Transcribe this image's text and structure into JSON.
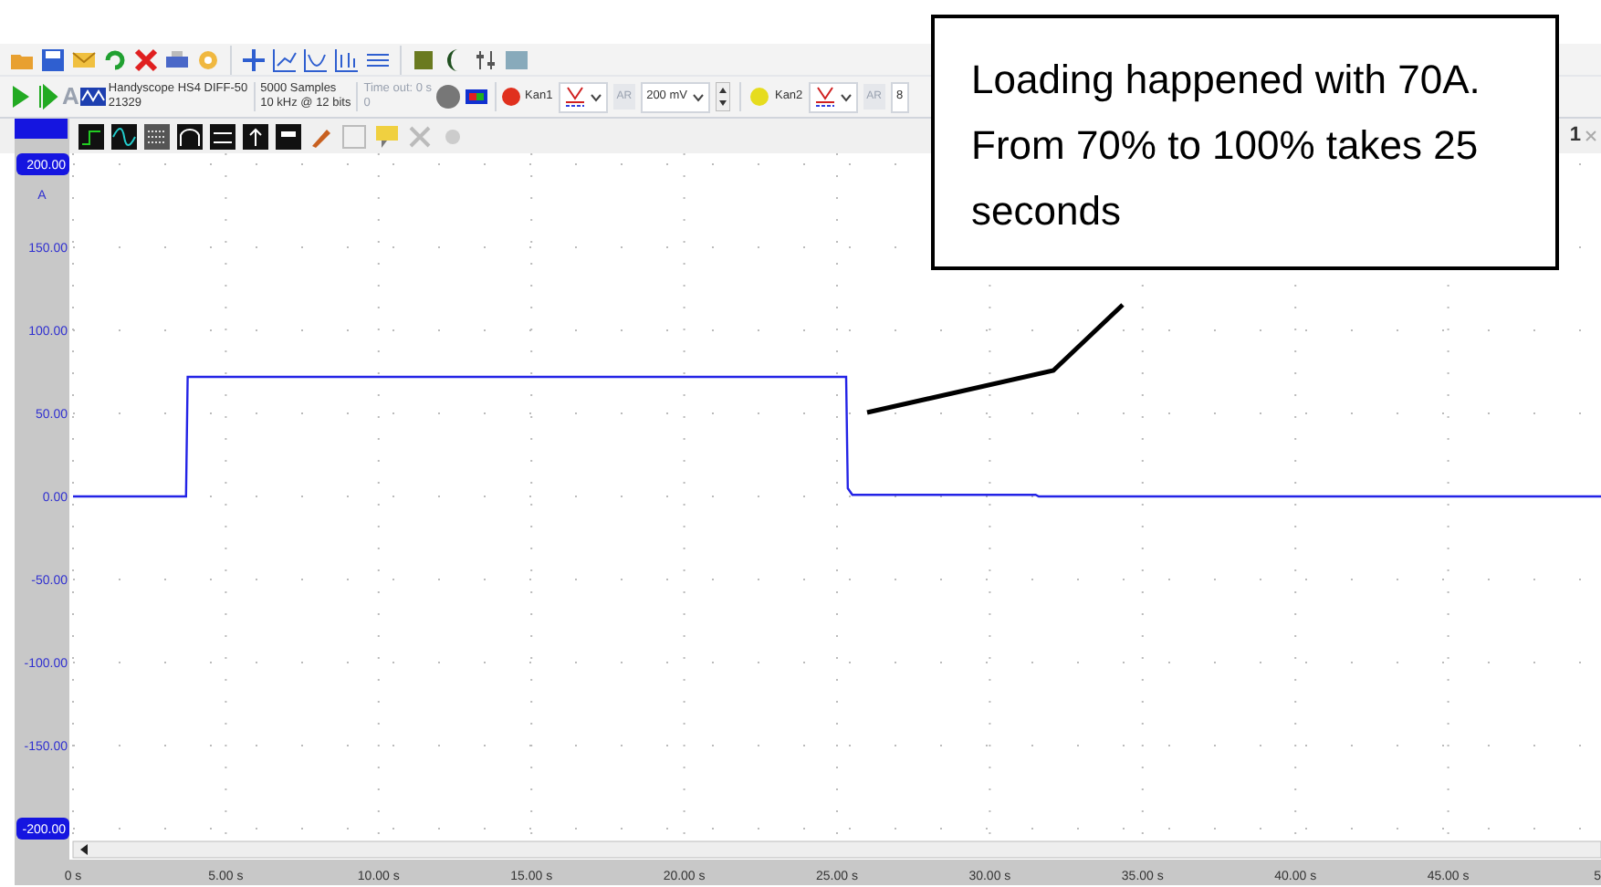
{
  "toolbar": {
    "disabled_letter": "A"
  },
  "device": {
    "name": "Handyscope HS4 DIFF-50",
    "serial": "21329"
  },
  "acquisition": {
    "samples": "5000 Samples",
    "rate": "10 kHz @ 12 bits"
  },
  "timeout": {
    "label": "Time out: 0 s",
    "value": "0"
  },
  "channels": [
    {
      "name": "Kan1",
      "color": "#e0301e",
      "ar": "AR",
      "range": "200 mV"
    },
    {
      "name": "Kan2",
      "color": "#e6dc1e",
      "ar": "AR",
      "range": "8"
    }
  ],
  "tab_label": "1",
  "chart": {
    "unit": "A",
    "x_edge_label": "5",
    "chart_data": {
      "type": "line",
      "xlim": [
        0,
        50
      ],
      "ylim": [
        -200,
        200
      ],
      "x": [
        0,
        3.7,
        3.75,
        25.3,
        25.35,
        25.5,
        31.5,
        31.6,
        50
      ],
      "series": [
        {
          "color": "#2323e6",
          "values": [
            0,
            0,
            72,
            72,
            5,
            1,
            1,
            0,
            0
          ]
        }
      ],
      "xticks": [
        {
          "value": 0,
          "label": "0 s"
        },
        {
          "value": 5,
          "label": "5.00 s"
        },
        {
          "value": 10,
          "label": "10.00 s"
        },
        {
          "value": 15,
          "label": "15.00 s"
        },
        {
          "value": 20,
          "label": "20.00 s"
        },
        {
          "value": 25,
          "label": "25.00 s"
        },
        {
          "value": 30,
          "label": "30.00 s"
        },
        {
          "value": 35,
          "label": "35.00 s"
        },
        {
          "value": 40,
          "label": "40.00 s"
        },
        {
          "value": 45,
          "label": "45.00 s"
        }
      ],
      "grid": true,
      "yticks": [
        {
          "value": -200,
          "label": "-200.00"
        },
        {
          "value": -150,
          "label": "-150.00"
        },
        {
          "value": -100,
          "label": "-100.00"
        },
        {
          "value": -50,
          "label": "-50.00"
        },
        {
          "value": 0,
          "label": "0.00"
        },
        {
          "value": 50,
          "label": "50.00"
        },
        {
          "value": 100,
          "label": "100.00"
        },
        {
          "value": 150,
          "label": "150.00"
        },
        {
          "value": 200,
          "label": "200.00"
        }
      ]
    }
  },
  "callout": {
    "text": "Loading happened with 70A. From 70% to 100% takes 25 seconds"
  }
}
